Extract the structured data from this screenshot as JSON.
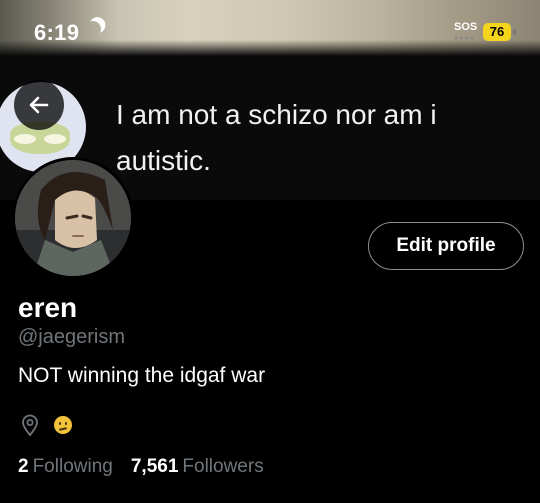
{
  "status_bar": {
    "time": "6:19",
    "sos": "SOS",
    "battery": "76",
    "icons": [
      "moon-icon",
      "battery-icon"
    ]
  },
  "banner": {
    "caption": "I am not a schizo nor am i autistic."
  },
  "profile": {
    "edit_label": "Edit profile",
    "display_name": "eren",
    "handle": "@jaegerism",
    "bio": "NOT winning the idgaf war",
    "stats": {
      "following_count": "2",
      "following_label": "Following",
      "followers_count": "7,561",
      "followers_label": "Followers"
    }
  },
  "icons": [
    "back-arrow-icon",
    "location-icon",
    "emoji-icon"
  ],
  "colors": {
    "background": "#000000",
    "muted": "#71767b",
    "battery": "#f4d51b"
  }
}
